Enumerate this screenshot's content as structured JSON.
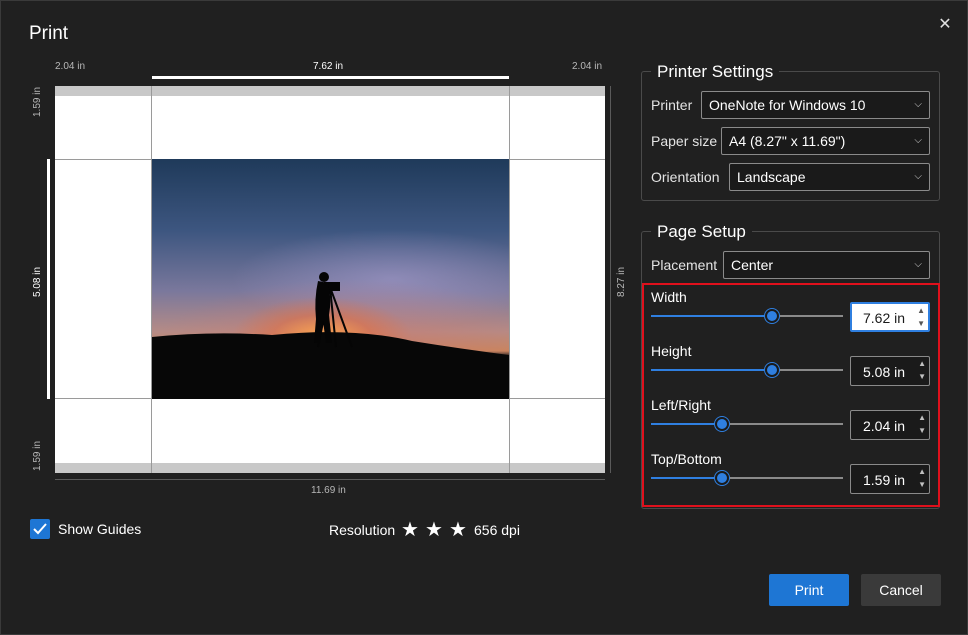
{
  "dialog": {
    "title": "Print",
    "close_glyph": "✕"
  },
  "preview": {
    "left_margin": "2.04 in",
    "image_width": "7.62 in",
    "right_margin": "2.04 in",
    "top_margin": "1.59 in",
    "image_height": "5.08 in",
    "bottom_margin": "1.59 in",
    "paper_height": "8.27 in",
    "paper_width": "11.69 in"
  },
  "printer_settings": {
    "title": "Printer Settings",
    "printer_label": "Printer",
    "printer_value": "OneNote for Windows 10",
    "paper_size_label": "Paper size",
    "paper_size_value": "A4 (8.27\" x 11.69\")",
    "orientation_label": "Orientation",
    "orientation_value": "Landscape"
  },
  "page_setup": {
    "title": "Page Setup",
    "placement_label": "Placement",
    "placement_value": "Center",
    "width": {
      "label": "Width",
      "value": "7.62 in",
      "level": 0.63
    },
    "height": {
      "label": "Height",
      "value": "5.08 in",
      "level": 0.63
    },
    "left_right": {
      "label": "Left/Right",
      "value": "2.04 in",
      "level": 0.37
    },
    "top_bottom": {
      "label": "Top/Bottom",
      "value": "1.59 in",
      "level": 0.37
    }
  },
  "footer": {
    "show_guides_label": "Show Guides",
    "show_guides_checked": true,
    "resolution_label": "Resolution",
    "resolution_stars": 3,
    "star_glyph": "★",
    "dpi": "656 dpi",
    "print_label": "Print",
    "cancel_label": "Cancel"
  },
  "colors": {
    "accent": "#1e76d4",
    "highlight_border": "#e0101c",
    "background": "#202020"
  },
  "icons": {
    "close": "close-icon",
    "dropdown": "chevron-down-icon",
    "check": "checkmark-icon",
    "star": "star-icon"
  }
}
